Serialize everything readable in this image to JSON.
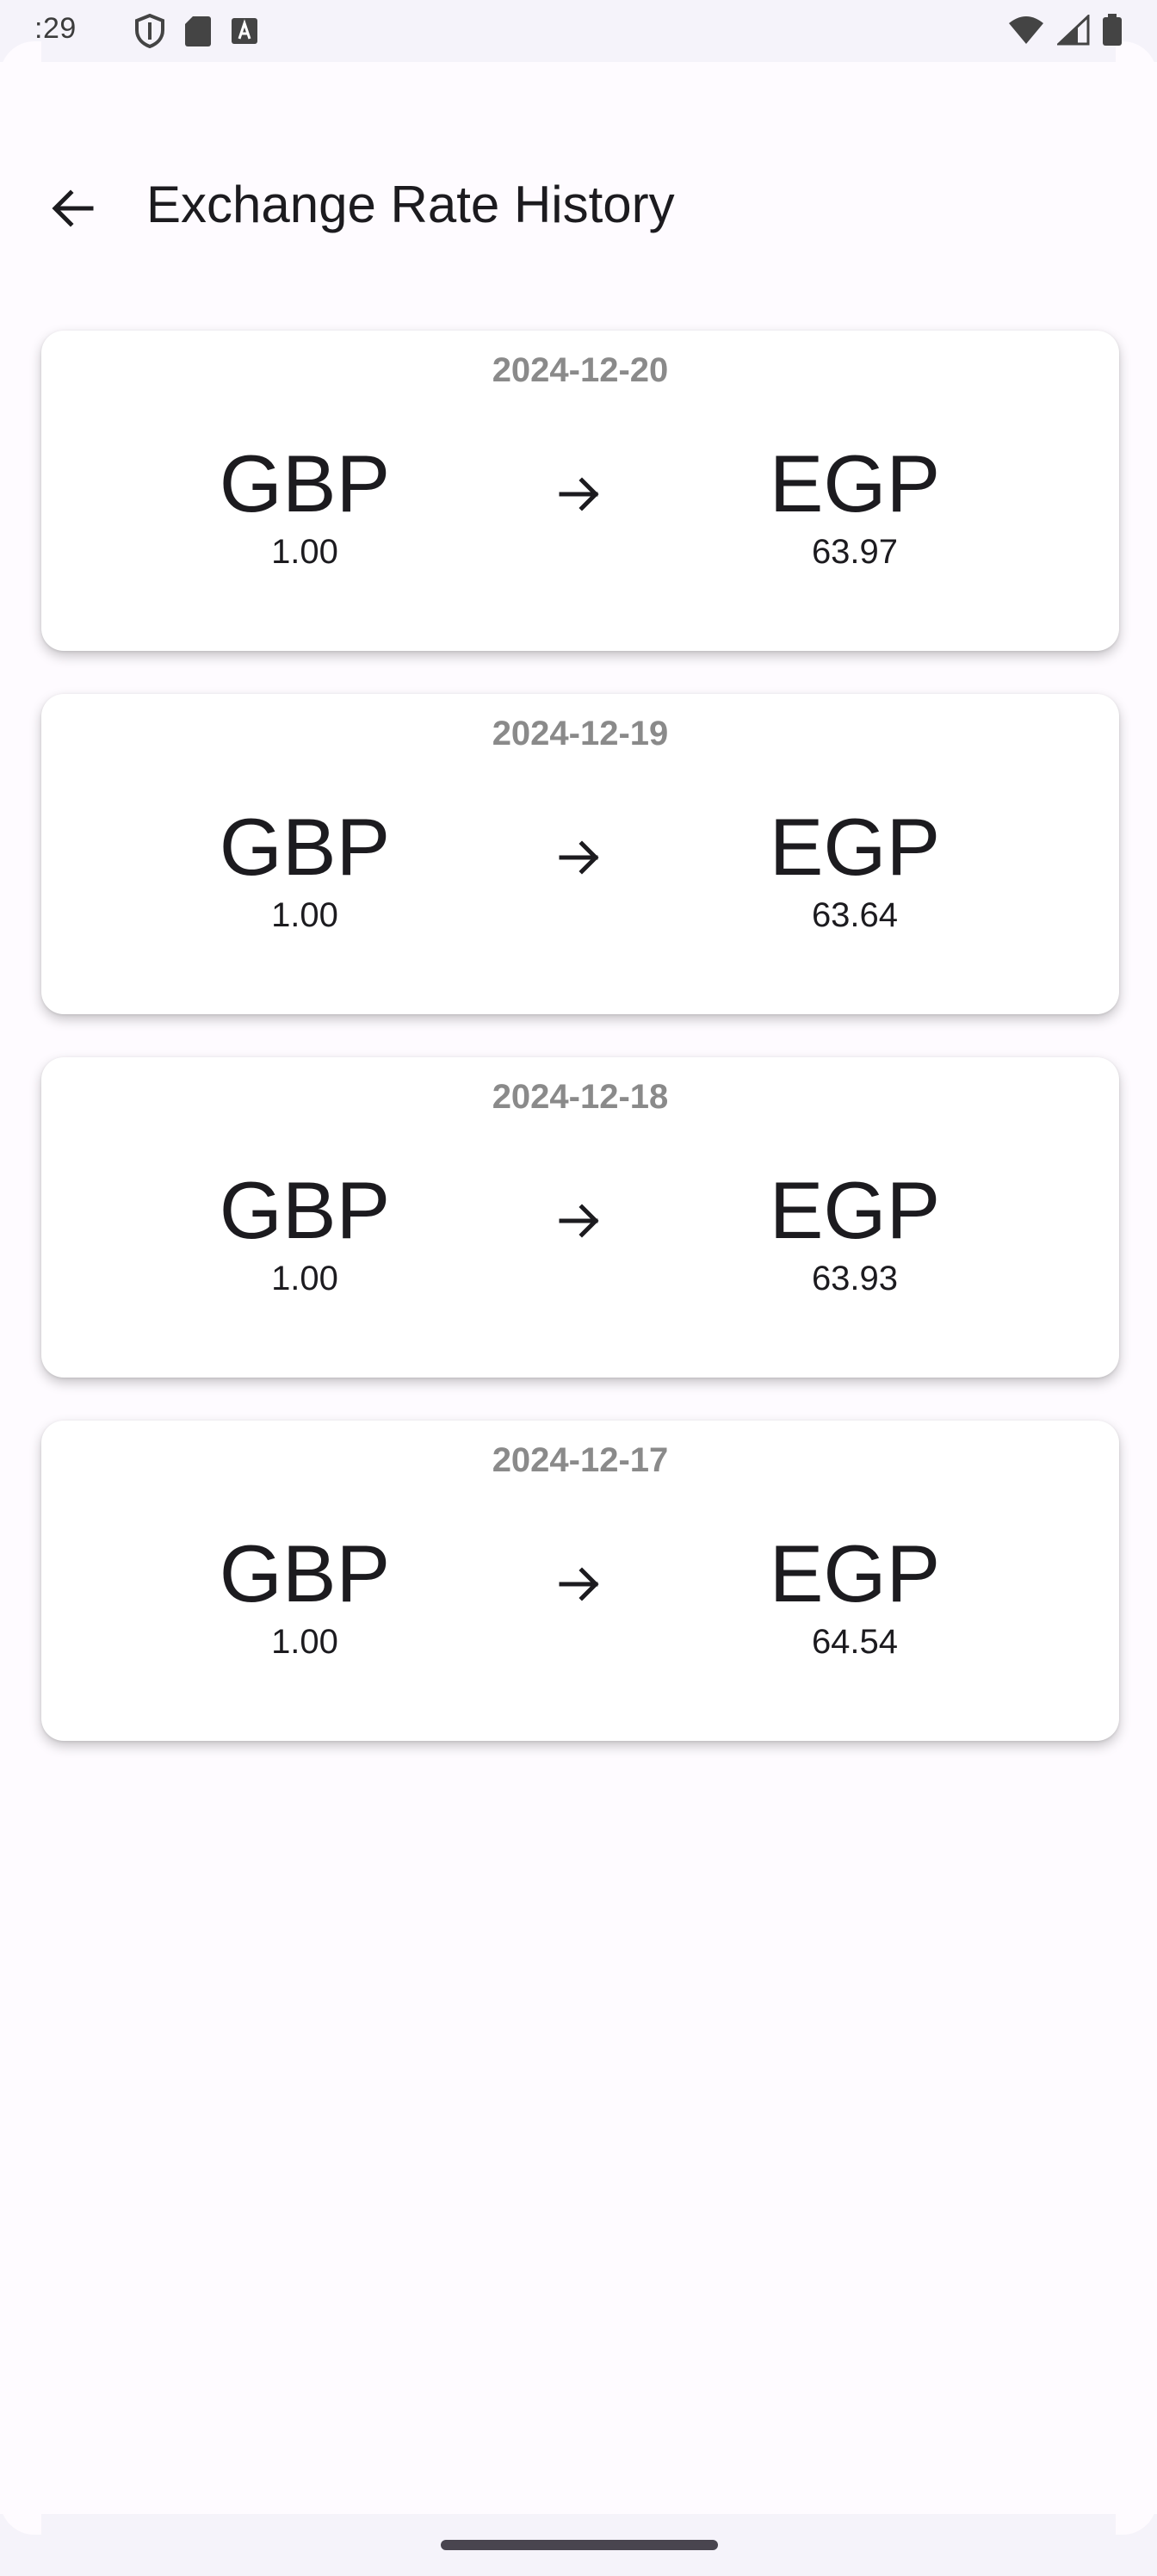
{
  "status_bar": {
    "time": ":29",
    "left_icons": [
      "shield-icon",
      "sd-card-icon",
      "text-a-icon"
    ],
    "right_icons": [
      "wifi-icon",
      "signal-icon",
      "battery-icon"
    ]
  },
  "app_bar": {
    "back_icon": "arrow-back-icon",
    "title": "Exchange Rate History"
  },
  "history": [
    {
      "date": "2024-12-20",
      "from_code": "GBP",
      "from_amount": "1.00",
      "to_code": "EGP",
      "to_amount": "63.97"
    },
    {
      "date": "2024-12-19",
      "from_code": "GBP",
      "from_amount": "1.00",
      "to_code": "EGP",
      "to_amount": "63.64"
    },
    {
      "date": "2024-12-18",
      "from_code": "GBP",
      "from_amount": "1.00",
      "to_code": "EGP",
      "to_amount": "63.93"
    },
    {
      "date": "2024-12-17",
      "from_code": "GBP",
      "from_amount": "1.00",
      "to_code": "EGP",
      "to_amount": "64.54"
    }
  ],
  "colors": {
    "background": "#fefbff",
    "card": "#ffffff",
    "date_text": "#8a8a8a",
    "primary_text": "#1c1b1f"
  }
}
